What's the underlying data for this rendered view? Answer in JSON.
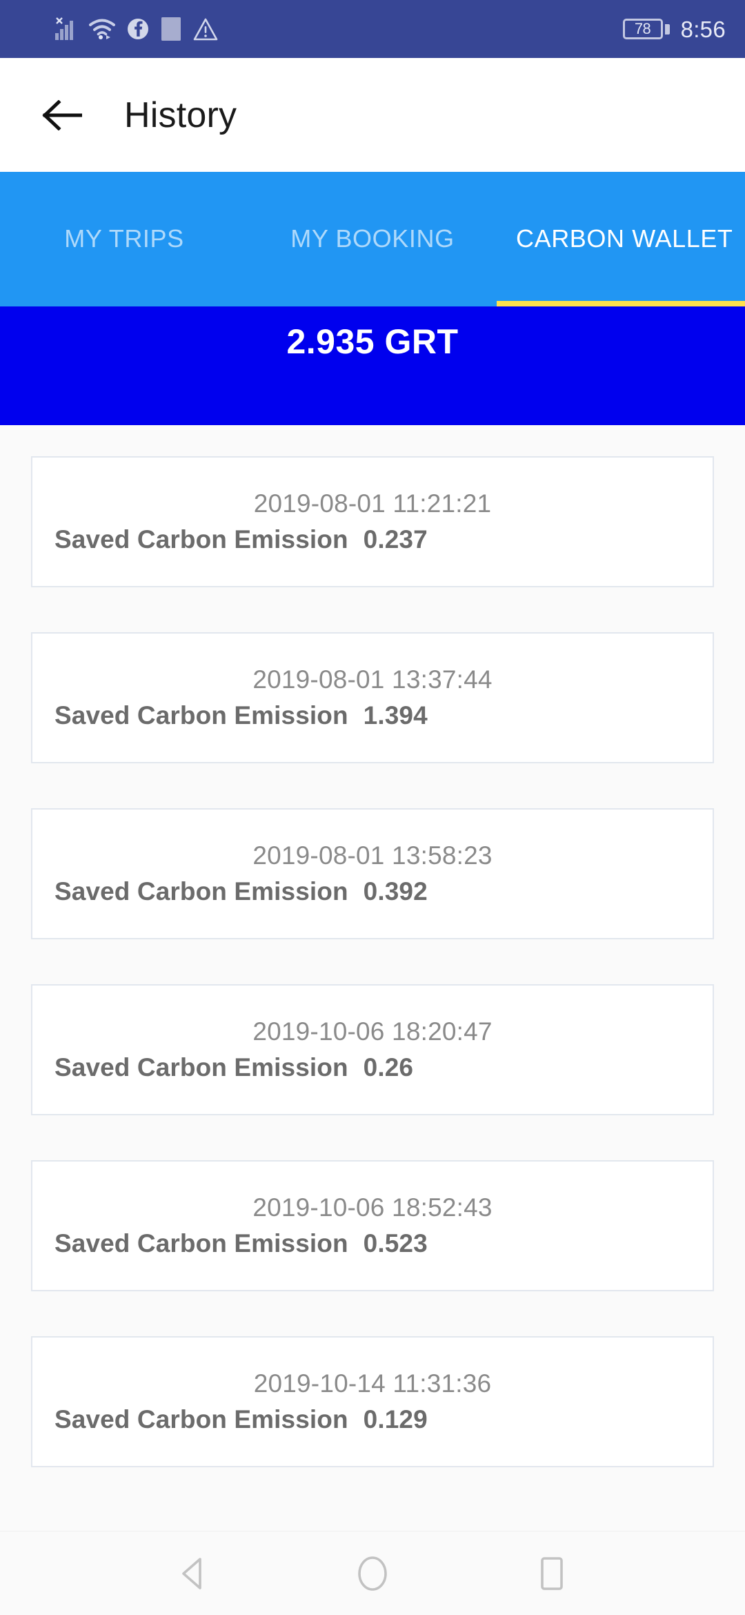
{
  "status_bar": {
    "icons": [
      "signal-icon",
      "wifi-icon",
      "facebook-icon",
      "app-icon",
      "warning-icon"
    ],
    "battery_level": "78",
    "time": "8:56",
    "background_color": "#374695"
  },
  "app_bar": {
    "back_icon": "back-arrow-icon",
    "title": "History"
  },
  "tabs": {
    "background_color": "#2196f3",
    "indicator_color": "#ffe14d",
    "items": [
      {
        "label": "MY TRIPS",
        "active": false
      },
      {
        "label": "MY BOOKING",
        "active": false
      },
      {
        "label": "CARBON WALLET",
        "active": true
      }
    ]
  },
  "balance": {
    "amount": "2.935 GRT",
    "background_color": "#0000ee"
  },
  "history": {
    "entry_label": "Saved Carbon Emission",
    "entries": [
      {
        "timestamp": "2019-08-01 11:21:21",
        "value": "0.237"
      },
      {
        "timestamp": "2019-08-01 13:37:44",
        "value": "1.394"
      },
      {
        "timestamp": "2019-08-01 13:58:23",
        "value": "0.392"
      },
      {
        "timestamp": "2019-10-06 18:20:47",
        "value": "0.26"
      },
      {
        "timestamp": "2019-10-06 18:52:43",
        "value": "0.523"
      },
      {
        "timestamp": "2019-10-14 11:31:36",
        "value": "0.129"
      }
    ]
  },
  "nav_bar": {
    "back": "nav-back-icon",
    "home": "nav-home-icon",
    "recents": "nav-recents-icon"
  }
}
